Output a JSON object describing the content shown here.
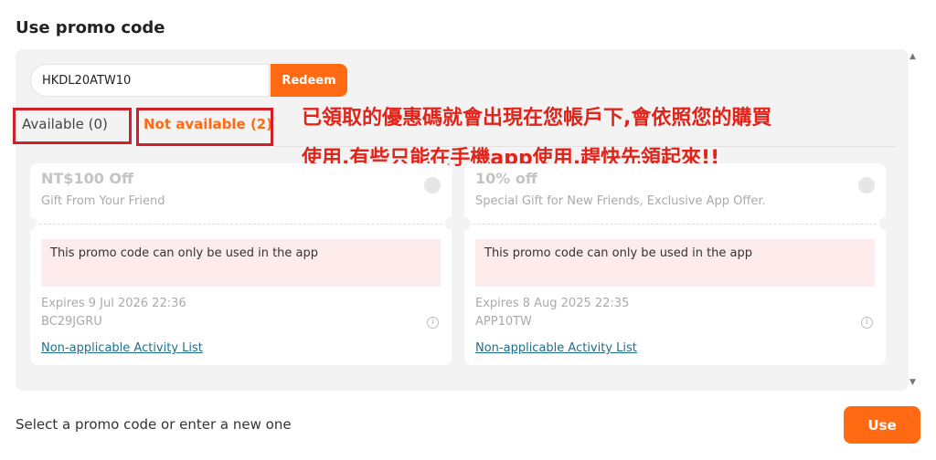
{
  "page": {
    "title": "Use promo code"
  },
  "promo_input": {
    "value": "HKDL20ATW10",
    "redeem_label": "Redeem"
  },
  "tabs": [
    {
      "label": "Available (0)",
      "active": false
    },
    {
      "label": "Not available (2)",
      "active": true
    }
  ],
  "annotation": {
    "line1": "已領取的優惠碼就會出現在您帳戶下,會依照您的購買",
    "line2": "使用,有些只能在手機app使用,趕快先領起來!!",
    "color": "#e2231a"
  },
  "coupons": [
    {
      "amount": "NT$100 Off",
      "subtitle": "Gift From Your Friend",
      "warning": "This promo code can only be used in the app",
      "expiry": "Expires 9 Jul 2026 22:36",
      "code": "BC29JGRU",
      "link": "Non-applicable Activity List"
    },
    {
      "amount": "10% off",
      "subtitle": "Special Gift for New Friends, Exclusive App Offer.",
      "warning": "This promo code can only be used in the app",
      "expiry": "Expires 8 Aug 2025 22:35",
      "code": "APP10TW",
      "link": "Non-applicable Activity List"
    }
  ],
  "footer": {
    "text": "Select a promo code or enter a new one",
    "use_label": "Use"
  },
  "icons": {
    "scroll_up": "▲",
    "scroll_down": "▼",
    "info": "i"
  },
  "colors": {
    "accent": "#ff6a13",
    "highlight_box": "#d0202a",
    "link": "#1f6f8b"
  }
}
